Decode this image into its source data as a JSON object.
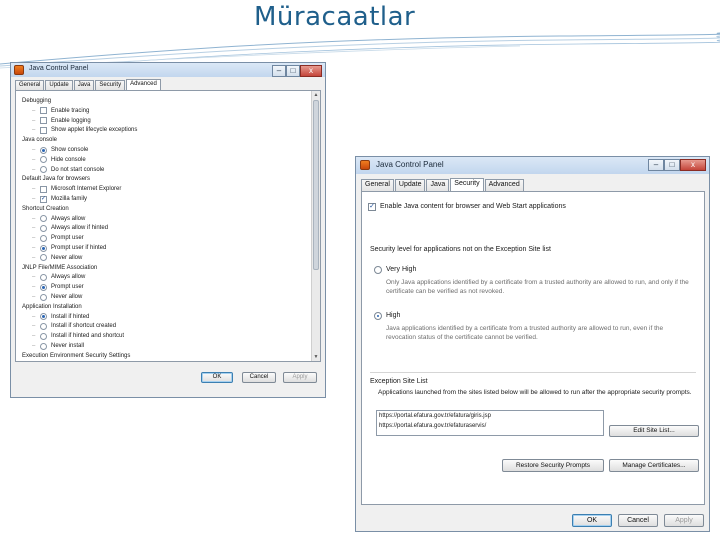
{
  "slide": {
    "title": "Müracaatlar"
  },
  "left_window": {
    "title": "Java Control Panel",
    "controls": {
      "minimize": "–",
      "maximize": "□",
      "close": "x"
    },
    "tabs": [
      "General",
      "Update",
      "Java",
      "Security",
      "Advanced"
    ],
    "active_tab": "Advanced",
    "tree": [
      {
        "kind": "cat",
        "label": "Debugging"
      },
      {
        "kind": "box",
        "checked": false,
        "label": "Enable tracing"
      },
      {
        "kind": "box",
        "checked": false,
        "label": "Enable logging"
      },
      {
        "kind": "box",
        "checked": false,
        "label": "Show applet lifecycle exceptions"
      },
      {
        "kind": "cat",
        "label": "Java console"
      },
      {
        "kind": "radio",
        "checked": true,
        "label": "Show console"
      },
      {
        "kind": "radio",
        "checked": false,
        "label": "Hide console"
      },
      {
        "kind": "radio",
        "checked": false,
        "label": "Do not start console"
      },
      {
        "kind": "cat",
        "label": "Default Java for browsers"
      },
      {
        "kind": "box",
        "checked": false,
        "label": "Microsoft Internet Explorer"
      },
      {
        "kind": "box",
        "checked": true,
        "label": "Mozilla family"
      },
      {
        "kind": "cat",
        "label": "Shortcut Creation"
      },
      {
        "kind": "radio",
        "checked": false,
        "label": "Always allow"
      },
      {
        "kind": "radio",
        "checked": false,
        "label": "Always allow if hinted"
      },
      {
        "kind": "radio",
        "checked": false,
        "label": "Prompt user"
      },
      {
        "kind": "radio",
        "checked": true,
        "label": "Prompt user if hinted"
      },
      {
        "kind": "radio",
        "checked": false,
        "label": "Never allow"
      },
      {
        "kind": "cat",
        "label": "JNLP File/MIME Association"
      },
      {
        "kind": "radio",
        "checked": false,
        "label": "Always allow"
      },
      {
        "kind": "radio",
        "checked": true,
        "label": "Prompt user"
      },
      {
        "kind": "radio",
        "checked": false,
        "label": "Never allow"
      },
      {
        "kind": "cat",
        "label": "Application Installation"
      },
      {
        "kind": "radio",
        "checked": true,
        "label": "Install if hinted"
      },
      {
        "kind": "radio",
        "checked": false,
        "label": "Install if shortcut created"
      },
      {
        "kind": "radio",
        "checked": false,
        "label": "Install if hinted and shortcut"
      },
      {
        "kind": "radio",
        "checked": false,
        "label": "Never install"
      },
      {
        "kind": "cat",
        "label": "Execution Environment Security Settings"
      }
    ],
    "buttons": {
      "ok": "OK",
      "cancel": "Cancel",
      "apply": "Apply"
    }
  },
  "right_window": {
    "title": "Java Control Panel",
    "controls": {
      "minimize": "–",
      "maximize": "□",
      "close": "x"
    },
    "tabs": [
      "General",
      "Update",
      "Java",
      "Security",
      "Advanced"
    ],
    "active_tab": "Security",
    "enable_checkbox": {
      "checked": true,
      "label": "Enable Java content for browser and Web Start applications"
    },
    "security_level_heading": "Security level for applications not on the Exception Site list",
    "levels": [
      {
        "label": "Very High",
        "selected": false,
        "description": "Only Java applications identified by a certificate from a trusted authority are allowed to run, and only if the certificate can be verified as not revoked."
      },
      {
        "label": "High",
        "selected": true,
        "description": "Java applications identified by a certificate from a trusted authority are allowed to run, even if the revocation status of the certificate cannot be verified."
      }
    ],
    "exception_heading": "Exception Site List",
    "exception_text": "Applications launched from the sites listed below will be allowed to run after the appropriate security prompts.",
    "sites": [
      "https://portal.efatura.gov.tr/efatura/giris.jsp",
      "https://portal.efatura.gov.tr/efaturaservis/"
    ],
    "buttons": {
      "edit_site_list": "Edit Site List...",
      "restore_prompts": "Restore Security Prompts",
      "manage_certificates": "Manage Certificates...",
      "ok": "OK",
      "cancel": "Cancel",
      "apply": "Apply"
    }
  }
}
